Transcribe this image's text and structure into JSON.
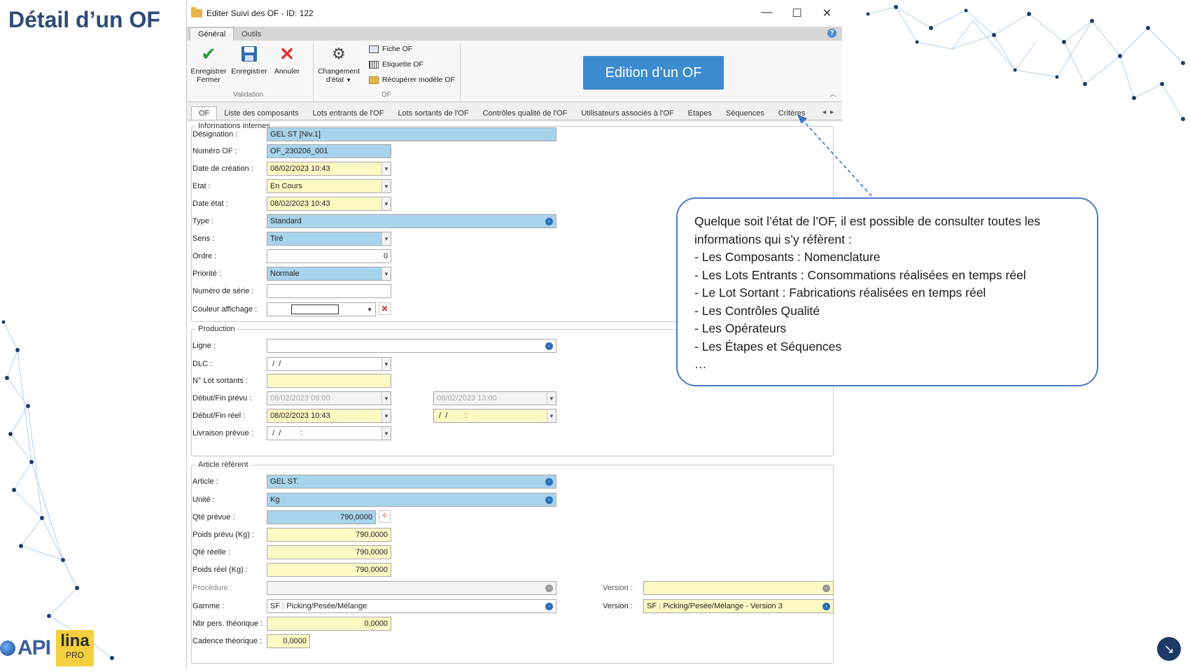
{
  "slide": {
    "title": "Détail d’un OF"
  },
  "window": {
    "title": "Editer Suivi des OF - ID: 122",
    "controls": [
      "—",
      "☐",
      "✕"
    ]
  },
  "ribbon_tabs": [
    "Général",
    "Outils"
  ],
  "ribbon": {
    "save_close": "Enregistrer\nFermer",
    "save": "Enregistrer",
    "cancel": "Annuler",
    "group_validation": "Validation",
    "change_state": "Changement\nd'état",
    "fiche_of": "Fiche OF",
    "etiquette_of": "Etiquette OF",
    "recuperer_modele": "Récupérer modèle OF",
    "group_of": "OF",
    "edition_badge": "Edition d’un OF"
  },
  "doc_tabs": [
    "OF",
    "Liste des composants",
    "Lots entrants de l'OF",
    "Lots sortants de l'OF",
    "Contrôles qualité de l'OF",
    "Utilisateurs associés à l'OF",
    "Etapes",
    "Séquences",
    "Critères"
  ],
  "info": {
    "legend": "Informations internes",
    "designation_label": "Désignation :",
    "designation_value": "GEL ST [Niv.1]",
    "numero_label": "Numéro OF :",
    "numero_value": "OF_230206_001",
    "date_creation_label": "Date de création :",
    "date_creation_value": "08/02/2023 10:43",
    "etat_label": "Etat :",
    "etat_value": "En Cours",
    "date_etat_label": "Date état :",
    "date_etat_value": "08/02/2023 10:43",
    "type_label": "Type :",
    "type_value": "Standard",
    "sens_label": "Sens :",
    "sens_value": "Tiré",
    "ordre_label": "Ordre :",
    "ordre_value": "0",
    "priorite_label": "Priorité :",
    "priorite_value": "Normale",
    "serie_label": "Numéro de série :",
    "serie_value": "",
    "couleur_label": "Couleur affichage :"
  },
  "production": {
    "legend": "Production",
    "ligne_label": "Ligne :",
    "ligne_value": "",
    "dlc_label": "DLC :",
    "dlc_value": " /  /",
    "lot_label": "N° Lot sortants :",
    "lot_value": "",
    "debut_prevu_label": "Début/Fin prévu :",
    "debut_prevu_value": "08/02/2023 09:00",
    "fin_prevu_value": "08/02/2023 13:00",
    "debut_reel_label": "Début/Fin réel :",
    "debut_reel_value": "08/02/2023 10:43",
    "fin_reel_value": " /  /        :",
    "livraison_label": "Livraison prévue :",
    "livraison_value": " /  /         :"
  },
  "article": {
    "legend": "Article référent",
    "article_label": "Article :",
    "article_value": "GEL ST.",
    "unite_label": "Unité :",
    "unite_value": "Kg",
    "qte_prevue_label": "Qté prévue :",
    "qte_prevue_value": "790,0000",
    "poids_prevu_label": "Poids prévu (Kg) :",
    "poids_prevu_value": "790,0000",
    "qte_reelle_label": "Qté réelle :",
    "qte_reelle_value": "790,0000",
    "poids_reel_label": "Poids réel (Kg) :",
    "poids_reel_value": "790,0000",
    "procedure_label": "Procédure :",
    "procedure_value": "",
    "version1_label": "Version :",
    "version1_value": "",
    "gamme_label": "Gamme :",
    "gamme_value": "SF : Picking/Pesée/Mélange",
    "version2_label": "Version :",
    "version2_value": "SF : Picking/Pesée/Mélange - Version 3",
    "nbr_label": "Nbr pers. théorique :",
    "nbr_value": "0,0000",
    "cadence_label": "Cadence théorique :",
    "cadence_value": "0,0000"
  },
  "callout": {
    "lines": [
      "Quelque soit l’état de l’OF, il est possible de consulter toutes les informations qui s’y réfèrent :",
      "- Les Composants : Nomenclature",
      "- Les Lots Entrants : Consommations réalisées en temps réel",
      "- Le Lot Sortant : Fabrications réalisées en temps réel",
      "- Les Contrôles Qualité",
      "- Les Opérateurs",
      "- Les Étapes et Séquences",
      "…"
    ]
  },
  "logo": {
    "api": "API",
    "lina": "lina",
    "pro": "PRO"
  },
  "colors": {
    "accent": "#3c8bd0",
    "field_blue": "#a8d3ec",
    "field_yellow": "#fff9c4",
    "callout_border": "#4b7bc7",
    "title": "#2e4a79"
  }
}
